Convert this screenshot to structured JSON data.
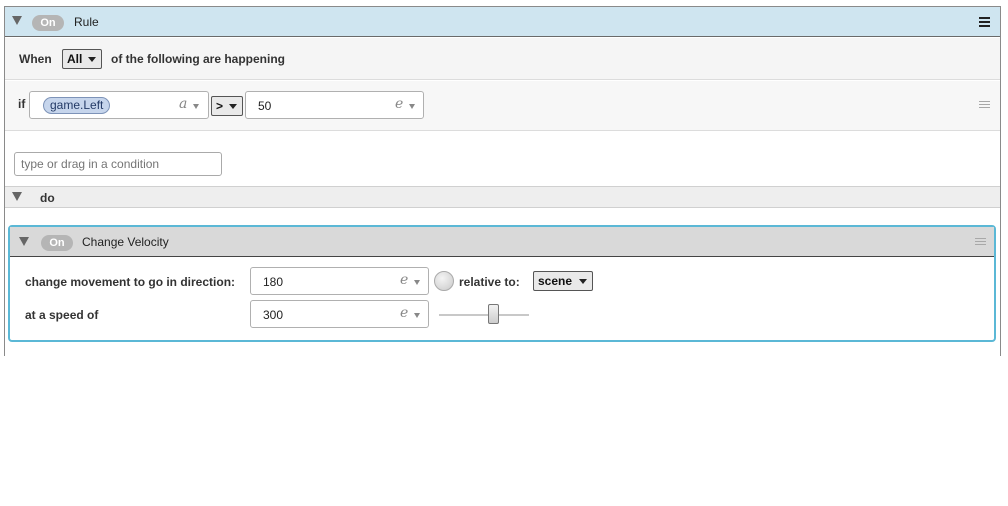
{
  "rule": {
    "toggle": "On",
    "title": "Rule",
    "icons": {
      "collapse": "triangle-down-icon",
      "menu": "hamburger-icon"
    },
    "when_label": "When",
    "match_mode": "All",
    "following_text": "of the following are happening",
    "condition": {
      "if_label": "if",
      "attribute": "game.Left",
      "attribute_type_char": "a",
      "operator": ">",
      "value": "50",
      "value_type_char": "e"
    },
    "condition_placeholder": "type or drag in a condition",
    "do_label": "do"
  },
  "action": {
    "toggle": "On",
    "title": "Change Velocity",
    "accent_color": "#5bb8d6",
    "direction_label": "change movement to go in direction:",
    "direction_value": "180",
    "direction_type_char": "e",
    "relative_label": "relative to:",
    "relative_value": "scene",
    "speed_label": "at a speed of",
    "speed_value": "300",
    "speed_type_char": "e",
    "speed_slider_level": 0.6
  }
}
